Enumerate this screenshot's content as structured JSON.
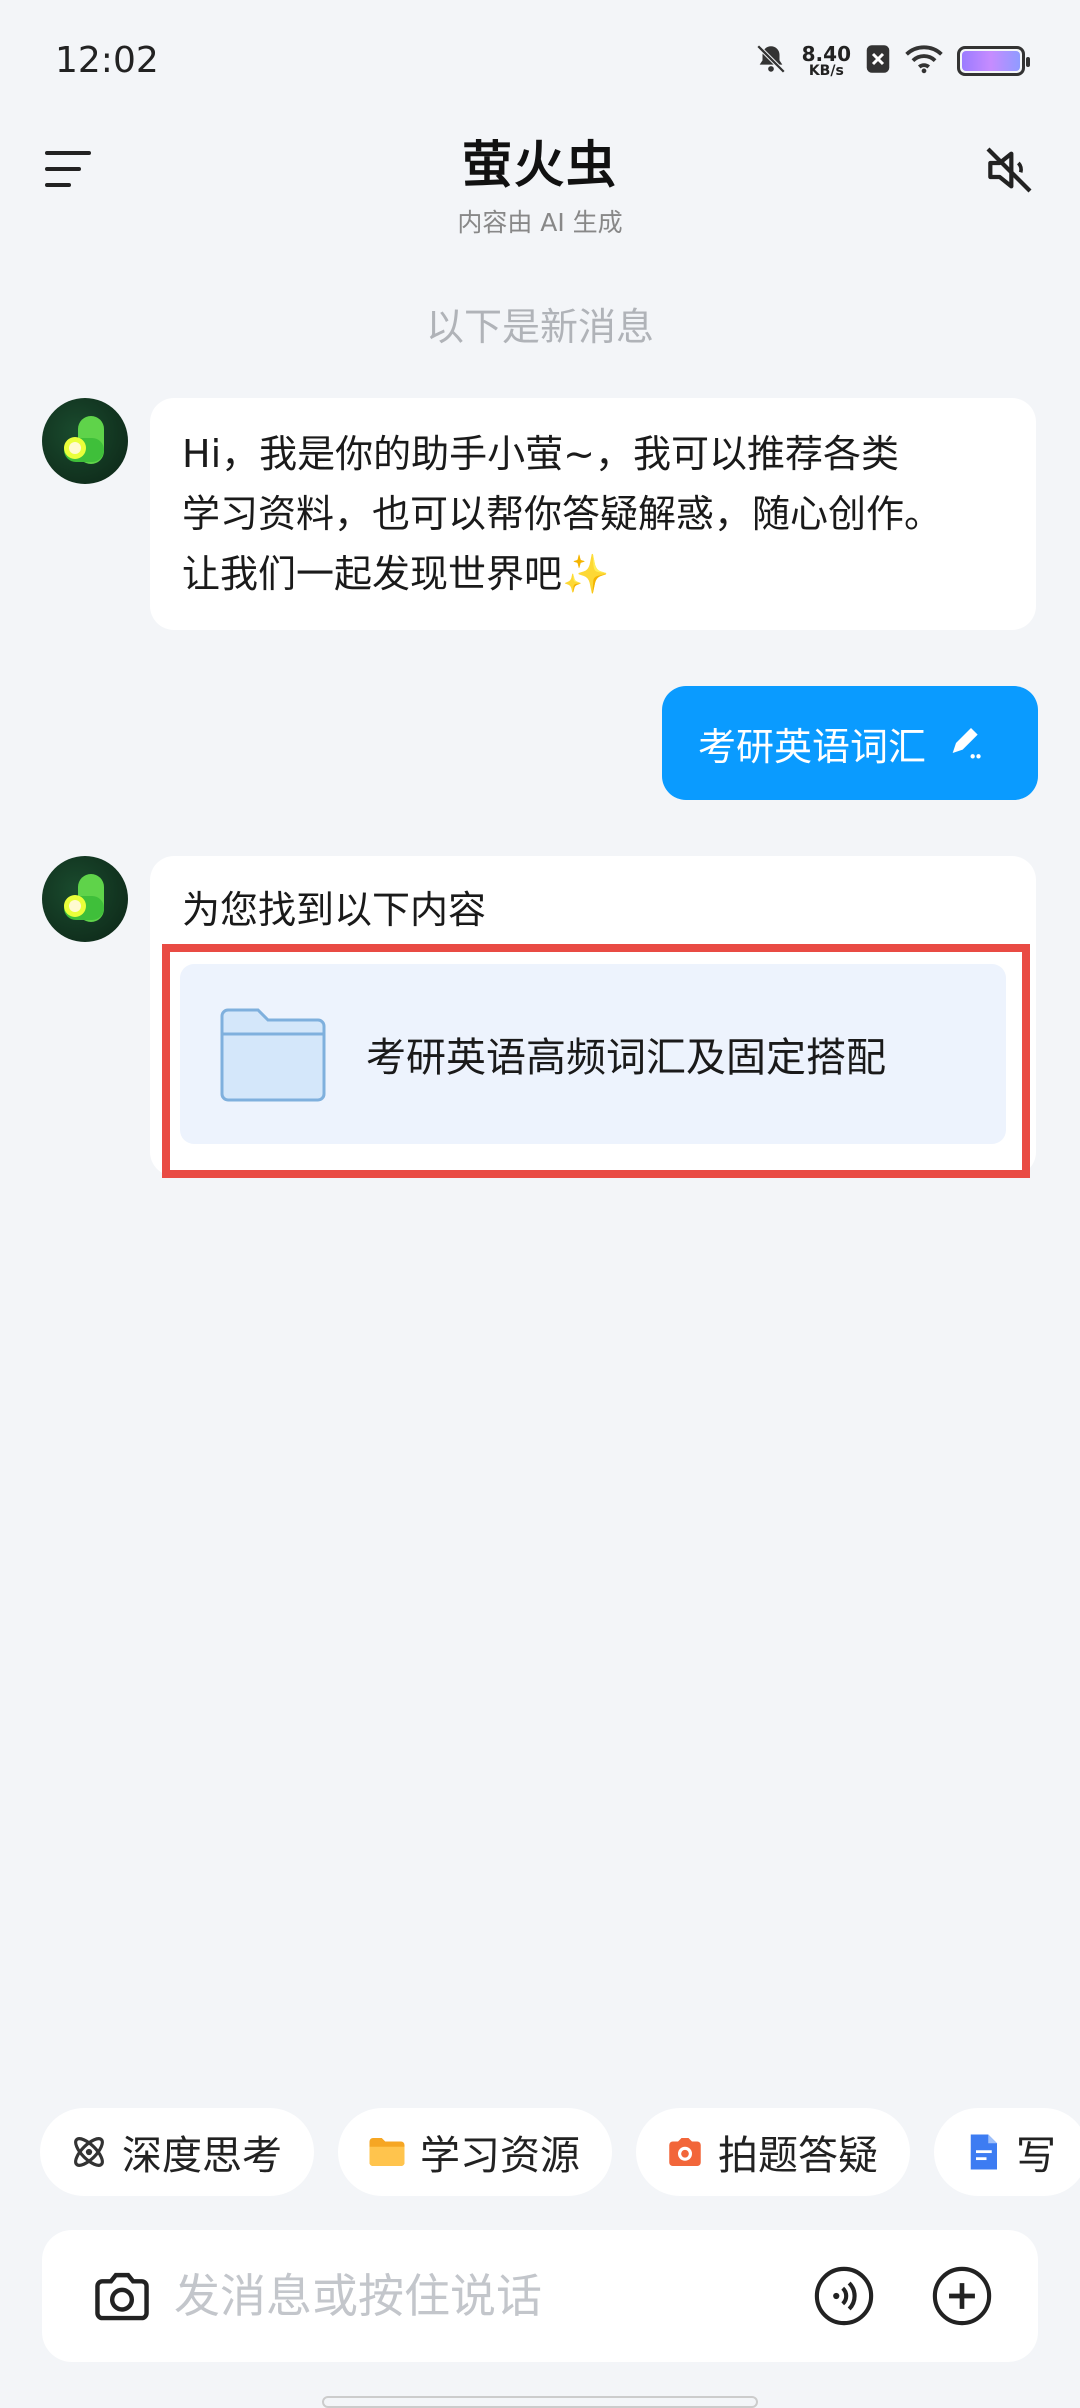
{
  "status_bar": {
    "time": "12:02",
    "net_speed_value": "8.40",
    "net_speed_unit": "KB/s",
    "icons": [
      "bell-off-icon",
      "sim-x-icon",
      "wifi-icon",
      "battery-icon"
    ]
  },
  "header": {
    "title": "萤火虫",
    "subtitle": "内容由 AI 生成",
    "icons": [
      "menu-icon",
      "speaker-mute-icon"
    ]
  },
  "divider": "以下是新消息",
  "messages": [
    {
      "role": "assistant",
      "lines": [
        "Hi，我是你的助手小萤~，我可以推荐各类",
        "学习资料，也可以帮你答疑解惑，随心创作。",
        "让我们一起发现世界吧✨"
      ]
    },
    {
      "role": "user",
      "text": "考研英语词汇"
    },
    {
      "role": "assistant",
      "text": "为您找到以下内容",
      "file": {
        "name": "考研英语高频词汇及固定搭配",
        "icon": "folder-icon"
      }
    }
  ],
  "chips": [
    {
      "label": "深度思考",
      "icon": "atom-icon"
    },
    {
      "label": "学习资源",
      "icon": "folder-icon"
    },
    {
      "label": "拍题答疑",
      "icon": "camera-icon"
    },
    {
      "label": "写",
      "icon": "document-icon"
    }
  ],
  "input": {
    "placeholder": "发消息或按住说话",
    "icons": [
      "camera-icon",
      "voice-icon",
      "plus-icon"
    ]
  },
  "colors": {
    "background": "#F3F5F8",
    "user_bubble": "#0A9BFF",
    "highlight": "#E94B44",
    "file_card": "#EDF3FD"
  }
}
